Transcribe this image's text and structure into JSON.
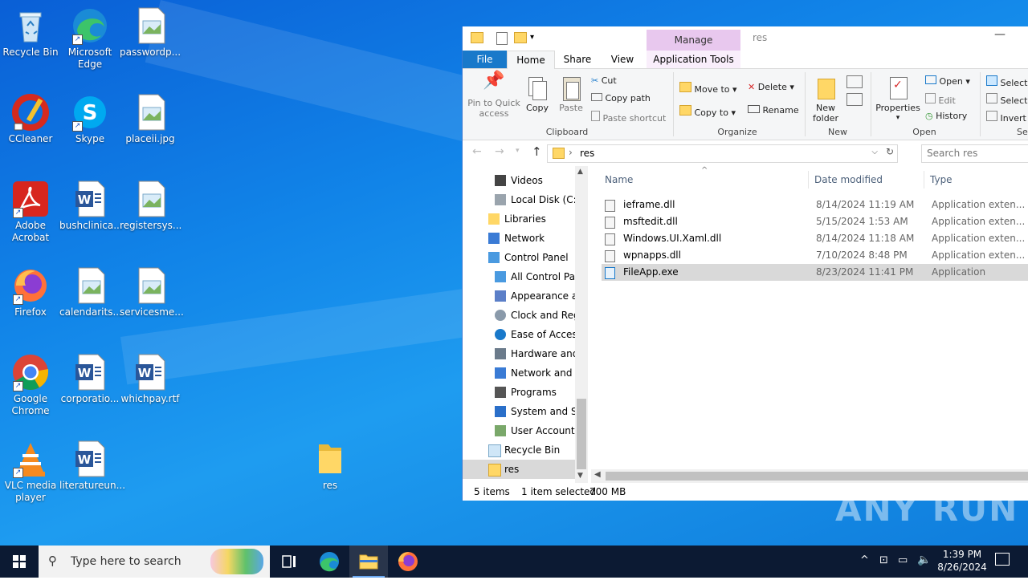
{
  "desktop": {
    "icons": [
      {
        "label": "Recycle Bin"
      },
      {
        "label": "Microsoft Edge"
      },
      {
        "label": "passwordp..."
      },
      {
        "label": "CCleaner"
      },
      {
        "label": "Skype"
      },
      {
        "label": "placeii.jpg"
      },
      {
        "label": "Adobe Acrobat"
      },
      {
        "label": "bushclinica..."
      },
      {
        "label": "registersys..."
      },
      {
        "label": "Firefox"
      },
      {
        "label": "calendarits..."
      },
      {
        "label": "servicesme..."
      },
      {
        "label": "Google Chrome"
      },
      {
        "label": "corporatio..."
      },
      {
        "label": "whichpay.rtf"
      },
      {
        "label": "VLC media player"
      },
      {
        "label": "literatureun..."
      },
      {
        "label": "res"
      }
    ]
  },
  "explorer": {
    "title": "res",
    "contextual_tab": "Manage",
    "tabs": [
      "File",
      "Home",
      "Share",
      "View",
      "Application Tools"
    ],
    "ribbon": {
      "pin": "Pin to Quick access",
      "copy": "Copy",
      "paste": "Paste",
      "cut": "Cut",
      "copy_path": "Copy path",
      "paste_shortcut": "Paste shortcut",
      "clipboard": "Clipboard",
      "move_to": "Move to",
      "copy_to": "Copy to",
      "delete": "Delete",
      "rename": "Rename",
      "organize": "Organize",
      "new_folder": "New folder",
      "new": "New",
      "properties": "Properties",
      "open": "Open",
      "edit": "Edit",
      "history": "History",
      "open_group": "Open",
      "select_all": "Select a",
      "select_none": "Select n",
      "invert": "Invert s",
      "select_group": "Sele"
    },
    "address": {
      "path": "res",
      "search_placeholder": "Search res"
    },
    "nav": [
      {
        "label": "Videos"
      },
      {
        "label": "Local Disk (C:)"
      },
      {
        "label": "Libraries"
      },
      {
        "label": "Network"
      },
      {
        "label": "Control Panel"
      },
      {
        "label": "All Control Par"
      },
      {
        "label": "Appearance an"
      },
      {
        "label": "Clock and Regi"
      },
      {
        "label": "Ease of Access"
      },
      {
        "label": "Hardware and"
      },
      {
        "label": "Network and In"
      },
      {
        "label": "Programs"
      },
      {
        "label": "System and Sec"
      },
      {
        "label": "User Accounts"
      },
      {
        "label": "Recycle Bin"
      },
      {
        "label": "res"
      }
    ],
    "columns": {
      "name": "Name",
      "date": "Date modified",
      "type": "Type"
    },
    "files": [
      {
        "name": "ieframe.dll",
        "date": "8/14/2024 11:19 AM",
        "type": "Application exten..."
      },
      {
        "name": "msftedit.dll",
        "date": "5/15/2024 1:53 AM",
        "type": "Application exten..."
      },
      {
        "name": "Windows.UI.Xaml.dll",
        "date": "8/14/2024 11:18 AM",
        "type": "Application exten..."
      },
      {
        "name": "wpnapps.dll",
        "date": "7/10/2024 8:48 PM",
        "type": "Application exten..."
      },
      {
        "name": "FileApp.exe",
        "date": "8/23/2024 11:41 PM",
        "type": "Application"
      }
    ],
    "status": {
      "count": "5 items",
      "selected": "1 item selected",
      "size": "700 MB"
    }
  },
  "taskbar": {
    "search_placeholder": "Type here to search",
    "time": "1:39 PM",
    "date": "8/26/2024"
  },
  "watermark": "ANY RUN",
  "colors": {
    "desktop": "#1184e8",
    "taskbar": "#0c1a33",
    "accent": "#1979ca",
    "selection": "#cce8ff"
  }
}
